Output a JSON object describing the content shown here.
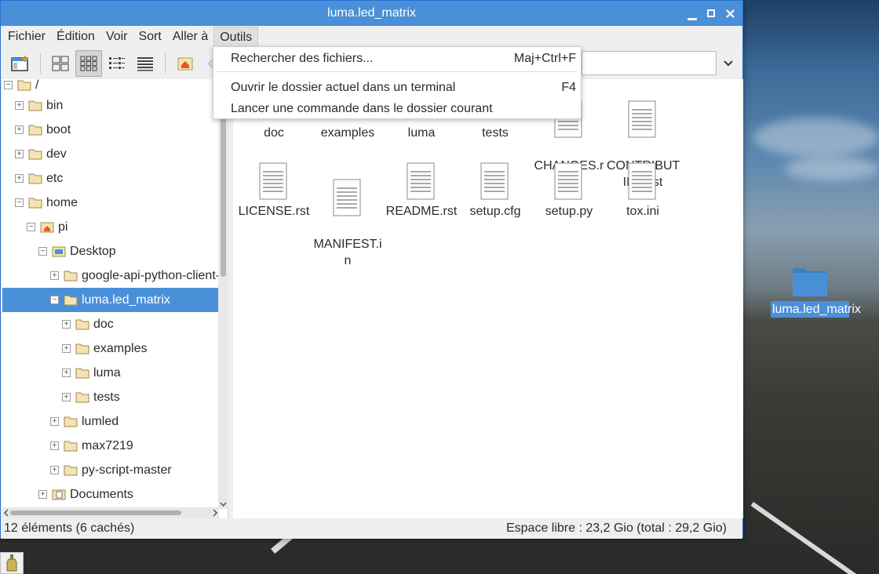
{
  "window": {
    "title": "luma.led_matrix"
  },
  "menubar": {
    "items": [
      "Fichier",
      "Édition",
      "Voir",
      "Sort",
      "Aller à",
      "Outils"
    ]
  },
  "dropdown": {
    "items": [
      {
        "label": "Rechercher des fichiers...",
        "shortcut": "Maj+Ctrl+F"
      },
      {
        "label": "Ouvrir le dossier actuel dans un terminal",
        "shortcut": "F4"
      },
      {
        "label": "Lancer une commande dans le dossier courant",
        "shortcut": ""
      }
    ]
  },
  "tree": {
    "root": "/",
    "items": [
      {
        "label": "bin",
        "expander": "+"
      },
      {
        "label": "boot",
        "expander": "+"
      },
      {
        "label": "dev",
        "expander": "+"
      },
      {
        "label": "etc",
        "expander": "+"
      },
      {
        "label": "home",
        "expander": "−"
      },
      {
        "label": "pi",
        "expander": "−"
      },
      {
        "label": "Desktop",
        "expander": "−"
      },
      {
        "label": "google-api-python-client-",
        "expander": "+"
      },
      {
        "label": "luma.led_matrix",
        "expander": "−"
      },
      {
        "label": "doc",
        "expander": "+"
      },
      {
        "label": "examples",
        "expander": "+"
      },
      {
        "label": "luma",
        "expander": "+"
      },
      {
        "label": "tests",
        "expander": "+"
      },
      {
        "label": "lumled",
        "expander": "+"
      },
      {
        "label": "max7219",
        "expander": "+"
      },
      {
        "label": "py-script-master",
        "expander": "+"
      },
      {
        "label": "Documents",
        "expander": "+"
      }
    ]
  },
  "files": {
    "row1": [
      "doc",
      "examples",
      "luma",
      "tests",
      "CHANGES.r\nst",
      "CONTRIBUT\nING.rst"
    ],
    "row2": [
      "LICENSE.rst",
      "MANIFEST.i\nn",
      "README.rst",
      "setup.cfg",
      "setup.py",
      "tox.ini"
    ]
  },
  "status": {
    "left": "12 éléments (6 cachés)",
    "right": "Espace libre : 23,2 Gio (total : 29,2 Gio)"
  },
  "desktop": {
    "icon_label": "luma.led_matrix"
  },
  "colors": {
    "accent": "#4a90d9",
    "folder": "#f3e3b5"
  }
}
